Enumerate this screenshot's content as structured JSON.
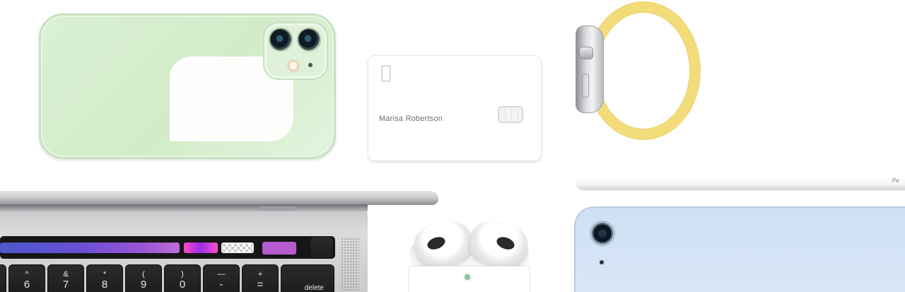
{
  "card": {
    "holder_name": "Marisa Robertson",
    "logo": "apple-logo"
  },
  "pencil": {
    "label": "Pe"
  },
  "macbook": {
    "keys": [
      {
        "top": "^",
        "bottom": "6"
      },
      {
        "top": "&",
        "bottom": "7"
      },
      {
        "top": "*",
        "bottom": "8"
      },
      {
        "top": "(",
        "bottom": "9"
      },
      {
        "top": ")",
        "bottom": "0"
      },
      {
        "top": "—",
        "bottom": "-"
      },
      {
        "top": "+",
        "bottom": "="
      }
    ],
    "delete_label": "delete"
  },
  "colors": {
    "iphone_body": "#d2ecc9",
    "watch_band": "#f2dc7a",
    "ipad_body": "#d8e7f7",
    "touchbar_accent": "#b65bd0"
  }
}
